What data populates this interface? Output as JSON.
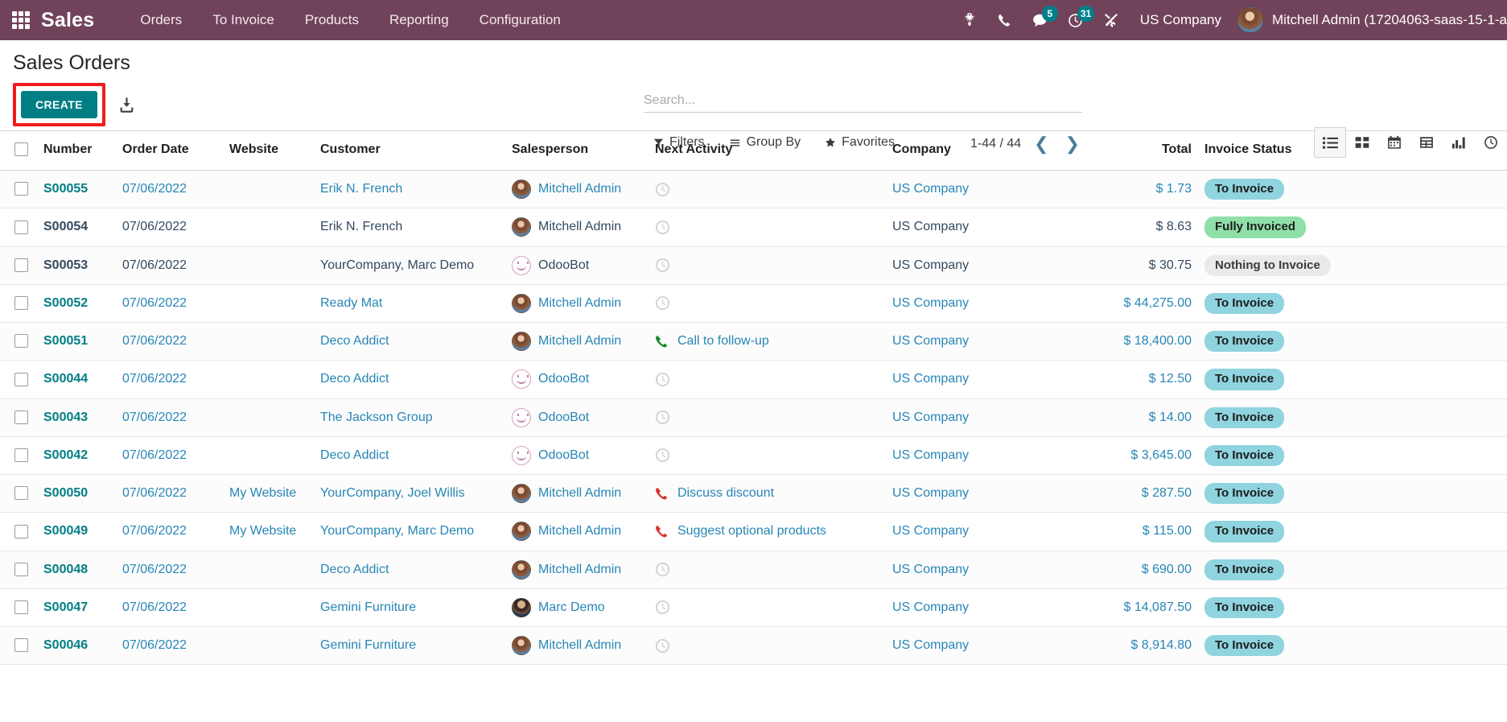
{
  "navbar": {
    "apps_icon": "apps-grid-icon",
    "brand": "Sales",
    "menu": [
      {
        "label": "Orders"
      },
      {
        "label": "To Invoice"
      },
      {
        "label": "Products"
      },
      {
        "label": "Reporting"
      },
      {
        "label": "Configuration"
      }
    ],
    "icons": [
      {
        "name": "bug-icon",
        "badge": null
      },
      {
        "name": "phone-icon",
        "badge": null
      },
      {
        "name": "messages-icon",
        "badge": "5"
      },
      {
        "name": "activities-clock-icon",
        "badge": "31"
      },
      {
        "name": "tools-icon",
        "badge": null
      }
    ],
    "company": "US Company",
    "user": "Mitchell Admin (17204063-saas-15-1-a",
    "accent": "#71435b",
    "badge_color": "#00808a"
  },
  "control_panel": {
    "title": "Sales Orders",
    "create_label": "CREATE",
    "create_color": "#017e84",
    "highlight_color": "#f01c1c",
    "import_icon": "import-download-icon",
    "search": {
      "placeholder": "Search...",
      "value": "",
      "icon": "search-icon"
    },
    "filters": [
      {
        "label": "Filters",
        "icon": "filter-funnel-icon"
      },
      {
        "label": "Group By",
        "icon": "group-by-lines-icon"
      },
      {
        "label": "Favorites",
        "icon": "star-icon"
      }
    ],
    "pager": {
      "range": "1-44 / 44",
      "prev_icon": "chevron-left-icon",
      "next_icon": "chevron-right-icon"
    },
    "views": [
      {
        "name": "list-view-icon",
        "active": true
      },
      {
        "name": "kanban-view-icon",
        "active": false
      },
      {
        "name": "calendar-view-icon",
        "active": false
      },
      {
        "name": "pivot-view-icon",
        "active": false
      },
      {
        "name": "graph-view-icon",
        "active": false
      },
      {
        "name": "activity-view-icon",
        "active": false
      }
    ]
  },
  "table": {
    "columns": [
      "Number",
      "Order Date",
      "Website",
      "Customer",
      "Salesperson",
      "Next Activity",
      "Company",
      "Total",
      "Invoice Status"
    ],
    "rows": [
      {
        "number": "S00055",
        "date": "07/06/2022",
        "website": "",
        "customer": "Erik N. French",
        "salesperson": "Mitchell Admin",
        "avatar": "mitchell",
        "activity": "",
        "activity_icon": "clock-icon",
        "company": "US Company",
        "total": "$ 1.73",
        "status": "To Invoice",
        "status_class": "st-toinvoice",
        "hl": true
      },
      {
        "number": "S00054",
        "date": "07/06/2022",
        "website": "",
        "customer": "Erik N. French",
        "salesperson": "Mitchell Admin",
        "avatar": "mitchell",
        "activity": "",
        "activity_icon": "clock-icon",
        "company": "US Company",
        "total": "$ 8.63",
        "status": "Fully Invoiced",
        "status_class": "st-fully",
        "hl": false
      },
      {
        "number": "S00053",
        "date": "07/06/2022",
        "website": "",
        "customer": "YourCompany, Marc Demo",
        "salesperson": "OdooBot",
        "avatar": "odoobot",
        "activity": "",
        "activity_icon": "clock-icon",
        "company": "US Company",
        "total": "$ 30.75",
        "status": "Nothing to Invoice",
        "status_class": "st-nothing",
        "hl": false
      },
      {
        "number": "S00052",
        "date": "07/06/2022",
        "website": "",
        "customer": "Ready Mat",
        "salesperson": "Mitchell Admin",
        "avatar": "mitchell",
        "activity": "",
        "activity_icon": "clock-icon",
        "company": "US Company",
        "total": "$ 44,275.00",
        "status": "To Invoice",
        "status_class": "st-toinvoice",
        "hl": true
      },
      {
        "number": "S00051",
        "date": "07/06/2022",
        "website": "",
        "customer": "Deco Addict",
        "salesperson": "Mitchell Admin",
        "avatar": "mitchell",
        "activity": "Call to follow-up",
        "activity_icon": "phone-green-icon",
        "company": "US Company",
        "total": "$ 18,400.00",
        "status": "To Invoice",
        "status_class": "st-toinvoice",
        "hl": true
      },
      {
        "number": "S00044",
        "date": "07/06/2022",
        "website": "",
        "customer": "Deco Addict",
        "salesperson": "OdooBot",
        "avatar": "odoobot",
        "activity": "",
        "activity_icon": "clock-icon",
        "company": "US Company",
        "total": "$ 12.50",
        "status": "To Invoice",
        "status_class": "st-toinvoice",
        "hl": true
      },
      {
        "number": "S00043",
        "date": "07/06/2022",
        "website": "",
        "customer": "The Jackson Group",
        "salesperson": "OdooBot",
        "avatar": "odoobot",
        "activity": "",
        "activity_icon": "clock-icon",
        "company": "US Company",
        "total": "$ 14.00",
        "status": "To Invoice",
        "status_class": "st-toinvoice",
        "hl": true
      },
      {
        "number": "S00042",
        "date": "07/06/2022",
        "website": "",
        "customer": "Deco Addict",
        "salesperson": "OdooBot",
        "avatar": "odoobot",
        "activity": "",
        "activity_icon": "clock-icon",
        "company": "US Company",
        "total": "$ 3,645.00",
        "status": "To Invoice",
        "status_class": "st-toinvoice",
        "hl": true
      },
      {
        "number": "S00050",
        "date": "07/06/2022",
        "website": "My Website",
        "customer": "YourCompany, Joel Willis",
        "salesperson": "Mitchell Admin",
        "avatar": "mitchell",
        "activity": "Discuss discount",
        "activity_icon": "phone-red-icon",
        "company": "US Company",
        "total": "$ 287.50",
        "status": "To Invoice",
        "status_class": "st-toinvoice",
        "hl": true
      },
      {
        "number": "S00049",
        "date": "07/06/2022",
        "website": "My Website",
        "customer": "YourCompany, Marc Demo",
        "salesperson": "Mitchell Admin",
        "avatar": "mitchell",
        "activity": "Suggest optional products",
        "activity_icon": "phone-red-icon",
        "company": "US Company",
        "total": "$ 115.00",
        "status": "To Invoice",
        "status_class": "st-toinvoice",
        "hl": true
      },
      {
        "number": "S00048",
        "date": "07/06/2022",
        "website": "",
        "customer": "Deco Addict",
        "salesperson": "Mitchell Admin",
        "avatar": "mitchell",
        "activity": "",
        "activity_icon": "clock-icon",
        "company": "US Company",
        "total": "$ 690.00",
        "status": "To Invoice",
        "status_class": "st-toinvoice",
        "hl": true
      },
      {
        "number": "S00047",
        "date": "07/06/2022",
        "website": "",
        "customer": "Gemini Furniture",
        "salesperson": "Marc Demo",
        "avatar": "marc",
        "activity": "",
        "activity_icon": "clock-icon",
        "company": "US Company",
        "total": "$ 14,087.50",
        "status": "To Invoice",
        "status_class": "st-toinvoice",
        "hl": true
      },
      {
        "number": "S00046",
        "date": "07/06/2022",
        "website": "",
        "customer": "Gemini Furniture",
        "salesperson": "Mitchell Admin",
        "avatar": "mitchell",
        "activity": "",
        "activity_icon": "clock-icon",
        "company": "US Company",
        "total": "$ 8,914.80",
        "status": "To Invoice",
        "status_class": "st-toinvoice",
        "hl": true
      }
    ]
  }
}
